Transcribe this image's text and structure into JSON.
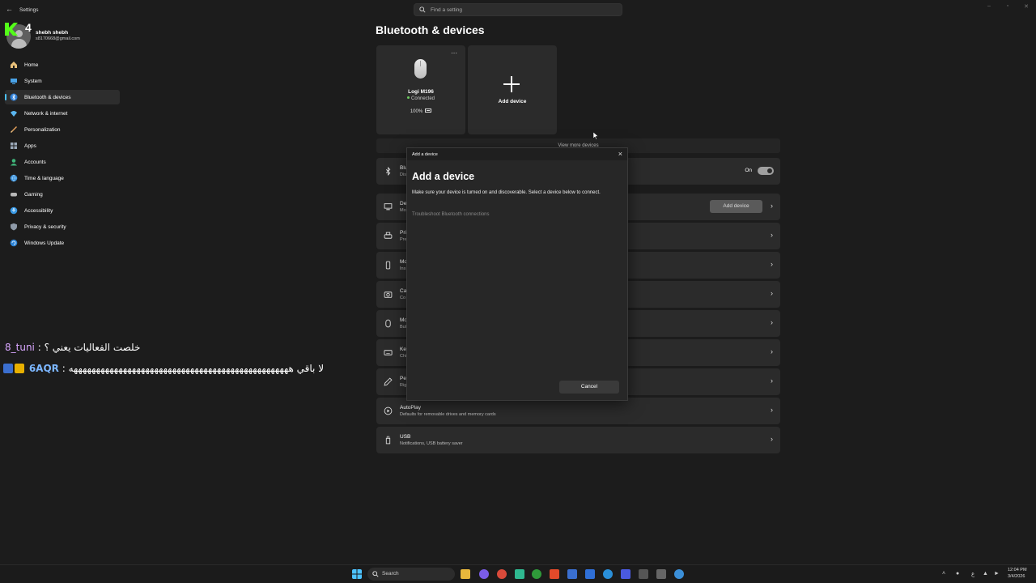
{
  "window": {
    "title": "Settings",
    "search_placeholder": "Find a setting"
  },
  "overlay_logo": {
    "number": "4"
  },
  "profile": {
    "name": "shebh shebh",
    "email": "s8170668@gmail.com"
  },
  "sidebar": {
    "items": [
      {
        "label": "Home",
        "icon": "home-icon"
      },
      {
        "label": "System",
        "icon": "system-icon"
      },
      {
        "label": "Bluetooth & devices",
        "icon": "bluetooth-icon",
        "active": true
      },
      {
        "label": "Network & internet",
        "icon": "wifi-icon"
      },
      {
        "label": "Personalization",
        "icon": "brush-icon"
      },
      {
        "label": "Apps",
        "icon": "apps-icon"
      },
      {
        "label": "Accounts",
        "icon": "accounts-icon"
      },
      {
        "label": "Time & language",
        "icon": "globe-icon"
      },
      {
        "label": "Gaming",
        "icon": "gaming-icon"
      },
      {
        "label": "Accessibility",
        "icon": "accessibility-icon"
      },
      {
        "label": "Privacy & security",
        "icon": "shield-icon"
      },
      {
        "label": "Windows Update",
        "icon": "update-icon"
      }
    ]
  },
  "chat": {
    "line1": {
      "user": "8_tuni",
      "sep": " : ",
      "message": "خلصت الفعاليات يعني ؟"
    },
    "line2": {
      "user": "6AQR",
      "sep": " : ",
      "message": "لا باقي هههههههههههههههههههههههههههههههههههههههههههههههههه"
    }
  },
  "main": {
    "title": "Bluetooth & devices",
    "device": {
      "name": "Logi M196",
      "status": "Connected",
      "battery": "100%"
    },
    "add_card_label": "Add device",
    "view_more": "View more devices",
    "rows": [
      {
        "title": "Blu",
        "subtitle": "Dis",
        "icon": "bluetooth-icon",
        "toggle_label": "On"
      },
      {
        "title": "De",
        "subtitle": "Mo",
        "icon": "devices-icon",
        "button": "Add device"
      },
      {
        "title": "Pri",
        "subtitle": "Pre",
        "icon": "printer-icon"
      },
      {
        "title": "Mo",
        "subtitle": "Ins",
        "icon": "phone-icon"
      },
      {
        "title": "Ca",
        "subtitle": "Co",
        "icon": "camera-icon"
      },
      {
        "title": "Mo",
        "subtitle": "But",
        "icon": "mouse-icon"
      },
      {
        "title": "Key",
        "subtitle": "Chi",
        "icon": "keyboard-icon"
      },
      {
        "title": "Pe",
        "subtitle": "Rig",
        "icon": "pen-icon"
      },
      {
        "title": "AutoPlay",
        "subtitle": "Defaults for removable drives and memory cards",
        "icon": "autoplay-icon"
      },
      {
        "title": "USB",
        "subtitle": "Notifications, USB battery saver",
        "icon": "usb-icon"
      }
    ]
  },
  "dialog": {
    "bar_title": "Add a device",
    "heading": "Add a device",
    "description": "Make sure your device is turned on and discoverable. Select a device below to connect.",
    "link": "Troubleshoot Bluetooth connections",
    "cancel": "Cancel"
  },
  "taskbar": {
    "search_label": "Search",
    "lang": "ع",
    "time": "12:04 PM",
    "date": "3/4/2026"
  },
  "colors": {
    "accent": "#4cc2ff",
    "background": "#1c1c1c",
    "card": "#2b2b2b",
    "connected_dot": "#6ccb5f"
  }
}
